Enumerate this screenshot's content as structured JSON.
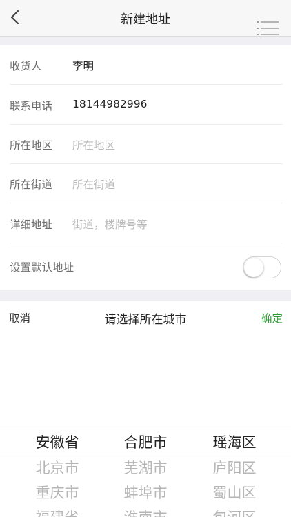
{
  "nav": {
    "title": "新建地址"
  },
  "form": {
    "receiver_label": "收货人",
    "receiver_value": "李明",
    "phone_label": "联系电话",
    "phone_value": "18144982996",
    "region_label": "所在地区",
    "region_placeholder": "所在地区",
    "street_label": "所在街道",
    "street_placeholder": "所在街道",
    "detail_label": "详细地址",
    "detail_placeholder": "街道，楼牌号等",
    "default_label": "设置默认地址"
  },
  "picker": {
    "cancel": "取消",
    "title": "请选择所在城市",
    "confirm": "确定",
    "provinces": [
      "安徽省",
      "北京市",
      "重庆市",
      "福建省"
    ],
    "cities": [
      "合肥市",
      "芜湖市",
      "蚌埠市",
      "淮南市"
    ],
    "districts": [
      "瑶海区",
      "庐阳区",
      "蜀山区",
      "包河区"
    ]
  }
}
